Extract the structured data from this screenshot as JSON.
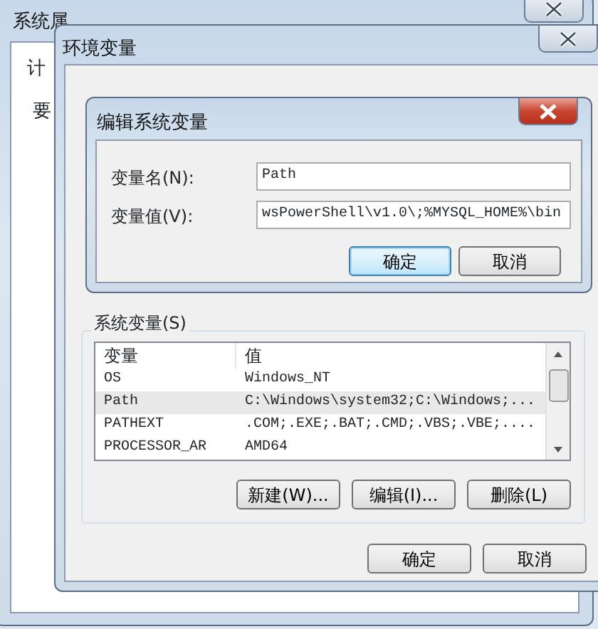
{
  "back_window": {
    "title": "系统属",
    "tab": "计",
    "label": "要"
  },
  "env_window": {
    "title": "环境变量",
    "system_variables": {
      "label": "系统变量(S)",
      "columns": [
        "变量",
        "值"
      ],
      "rows": [
        {
          "name": "OS",
          "value": "Windows_NT",
          "selected": false
        },
        {
          "name": "Path",
          "value": "C:\\Windows\\system32;C:\\Windows;...",
          "selected": true
        },
        {
          "name": "PATHEXT",
          "value": ".COM;.EXE;.BAT;.CMD;.VBS;.VBE;....",
          "selected": false
        },
        {
          "name": "PROCESSOR_AR",
          "value": "AMD64",
          "selected": false
        }
      ],
      "buttons": [
        "新建(W)...",
        "编辑(I)...",
        "删除(L)"
      ]
    },
    "buttons": [
      "确定",
      "取消"
    ]
  },
  "edit_dialog": {
    "title": "编辑系统变量",
    "fields": [
      {
        "label": "变量名(N):",
        "value": "Path"
      },
      {
        "label": "变量值(V):",
        "value": "wsPowerShell\\v1.0\\;%MYSQL_HOME%\\bin"
      }
    ],
    "buttons": [
      {
        "label": "确定",
        "default": true
      },
      {
        "label": "取消",
        "default": false
      }
    ]
  }
}
